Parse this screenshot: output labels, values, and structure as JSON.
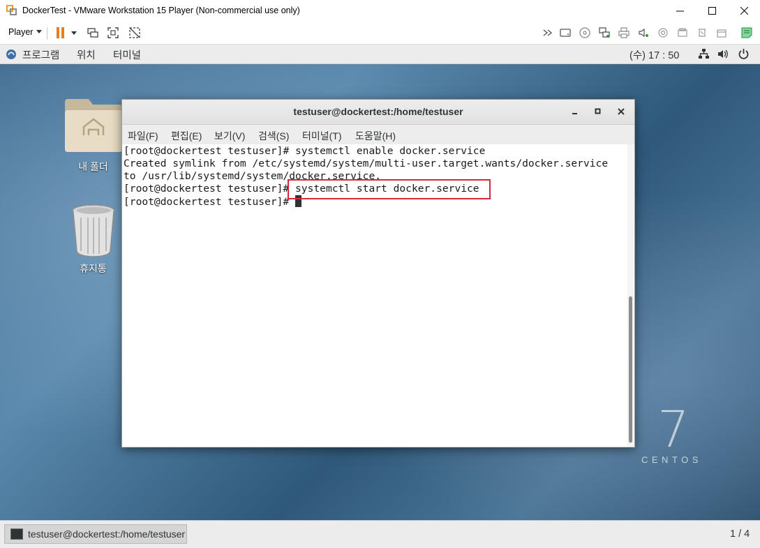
{
  "vmware": {
    "window_title": "DockerTest - VMware Workstation 15 Player (Non-commercial use only)",
    "player_menu": "Player",
    "accent_color": "#ed7d1c"
  },
  "gnome_bar": {
    "menu_applications": "프로그램",
    "menu_places": "위치",
    "menu_terminal": "터미널",
    "clock": "(수) 17 : 50"
  },
  "desktop": {
    "home_folder_label": "내 폴더",
    "trash_label": "휴지통",
    "brand_number": "7",
    "brand_word": "CENTOS"
  },
  "terminal": {
    "title": "testuser@dockertest:/home/testuser",
    "menus": [
      "파일(F)",
      "편집(E)",
      "보기(V)",
      "검색(S)",
      "터미널(T)",
      "도움말(H)"
    ],
    "lines": [
      "[root@dockertest testuser]# systemctl enable docker.service",
      "Created symlink from /etc/systemd/system/multi-user.target.wants/docker.service",
      "to /usr/lib/systemd/system/docker.service.",
      "[root@dockertest testuser]# systemctl start docker.service",
      "[root@dockertest testuser]# "
    ],
    "highlight_color": "#d8263a"
  },
  "taskbar": {
    "window_button_label": "testuser@dockertest:/home/testuser",
    "workspace_indicator": "1 / 4"
  }
}
